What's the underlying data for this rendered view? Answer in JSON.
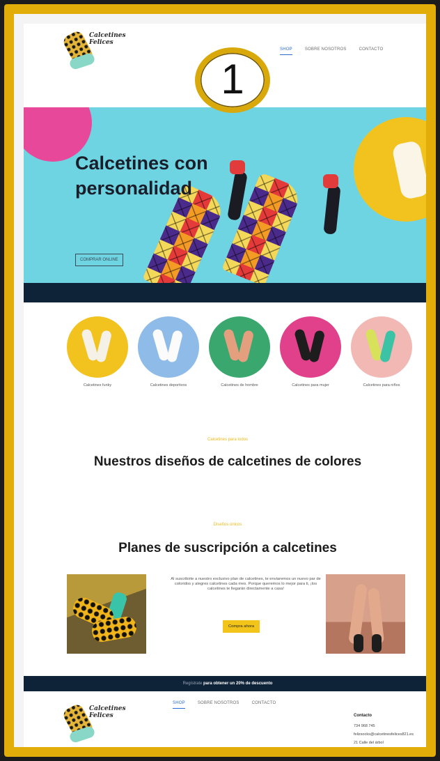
{
  "brand": {
    "logo_text_line1": "Calcetines",
    "logo_text_line2": "Felices"
  },
  "nav": {
    "items": [
      "SHOP",
      "SOBRE NOSOTROS",
      "CONTACTO"
    ],
    "active_index": 0
  },
  "step_badge": "1",
  "hero": {
    "title": "Calcetines con personalidad",
    "button": "COMPRAR ONLINE"
  },
  "categories": [
    {
      "label": "Calcetines funky",
      "color": "#f2c21e"
    },
    {
      "label": "Calcetines deportivos",
      "color": "#8fbbe9"
    },
    {
      "label": "Calcetines de hombre",
      "color": "#3aa86e"
    },
    {
      "label": "Calcetines para mujer",
      "color": "#e0418a"
    },
    {
      "label": "Calcetines para niños",
      "color": "#f1b8b4"
    }
  ],
  "designs": {
    "kicker": "Calcetines para todos",
    "heading": "Nuestros diseños de calcetines de colores"
  },
  "subscription": {
    "kicker": "Diseños únicos",
    "heading": "Planes de suscripción a calcetines",
    "text": "Al suscribirte a nuestro exclusivo plan de calcetines, te enviaremos un nuevo par de coloridos y alegres calcetines cada mes. Porque queremos lo mejor para ti, ¡los calcetines te llegarán directamente a casa!",
    "button": "Compra ahora"
  },
  "promo": {
    "prefix": "Regístrate",
    "bold": "para obtener un 20% de descuento"
  },
  "footer": {
    "nav": [
      "SHOP",
      "SOBRE NOSOTROS",
      "CONTACTO"
    ],
    "contact_title": "Contacto",
    "phone": "734 968 745",
    "email": "felizsocks@calcetinesfelices821.es",
    "address": "21 Calle del árbol"
  },
  "colors": {
    "accent": "#f3c51a",
    "frame": "#e2ac09",
    "dark": "#0e2238",
    "hero_bg": "#6fd4e2",
    "nav_active": "#2a6bd6"
  }
}
